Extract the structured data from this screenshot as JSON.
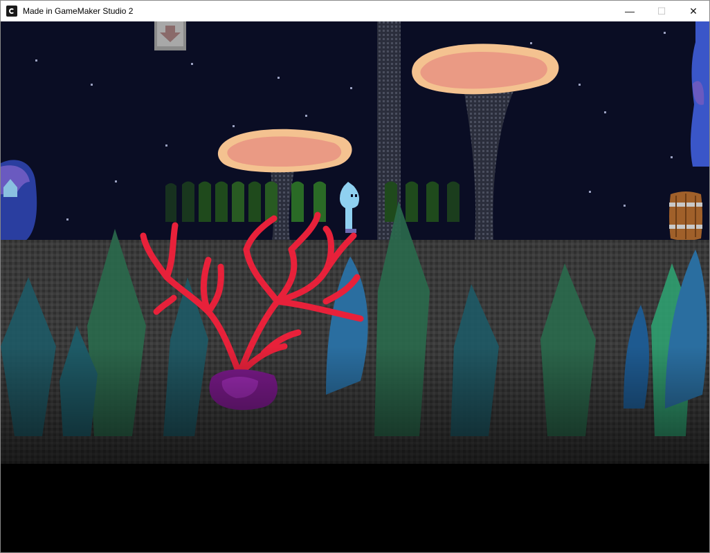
{
  "window": {
    "title": "Made in GameMaker Studio 2",
    "controls": {
      "minimize": "—",
      "maximize": "☐",
      "close": "✕"
    }
  },
  "icons": {
    "app": "gamemaker-icon",
    "hud_indicator": "down-arrow-icon"
  },
  "colors": {
    "sky": "#0a0d24",
    "ground": "#3a3a3a",
    "coral": "#e8213a",
    "mushroom_cap": "#f3b08a",
    "player": "#8fd0f0",
    "shadow_figures": "#1f4a1c",
    "kelp_teal": "#1e5a66",
    "kelp_green": "#2a6a4c",
    "kelp_blue": "#2a6ea0"
  }
}
